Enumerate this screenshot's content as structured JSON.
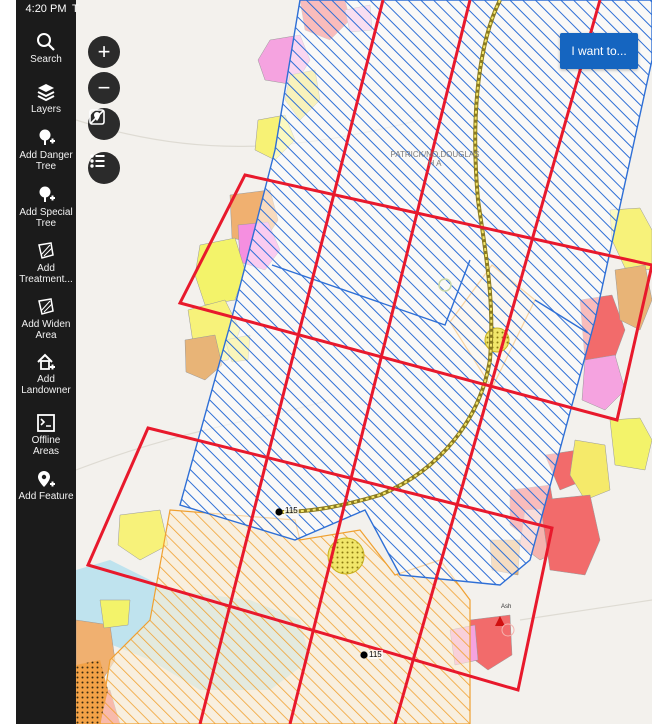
{
  "status_bar": {
    "time": "4:20 PM",
    "extra": "T"
  },
  "sidebar": {
    "items": [
      {
        "label": "Search",
        "icon": "search-icon"
      },
      {
        "label": "Layers",
        "icon": "layers-icon"
      },
      {
        "label": "Add Danger\nTree",
        "icon": "add-tree-icon"
      },
      {
        "label": "Add Special\nTree",
        "icon": "add-tree-icon"
      },
      {
        "label": "Add\nTreatment...",
        "icon": "add-polygon-icon"
      },
      {
        "label": "Add Widen\nArea",
        "icon": "add-polygon-icon"
      },
      {
        "label": "Add\nLandowner",
        "icon": "add-home-icon"
      },
      {
        "label": "Offline\nAreas",
        "icon": "offline-map-icon"
      },
      {
        "label": "Add Feature",
        "icon": "add-pin-icon"
      }
    ]
  },
  "map_controls": {
    "zoom_in": "+",
    "zoom_out": "−",
    "want_button": "I want to..."
  },
  "map_labels": {
    "region_line1": "PATRICK/NO.DOUGLAS",
    "region_line2": "H A",
    "marker_top": "115",
    "marker_bottom": "115",
    "feature_label": "Ash"
  },
  "colors": {
    "accent_blue": "#1565c0",
    "grid_red": "#e8192c",
    "hatch_blue": "#2e6fd6",
    "hatch_orange": "#f0a030",
    "sidebar_bg": "#1b1b1b"
  }
}
